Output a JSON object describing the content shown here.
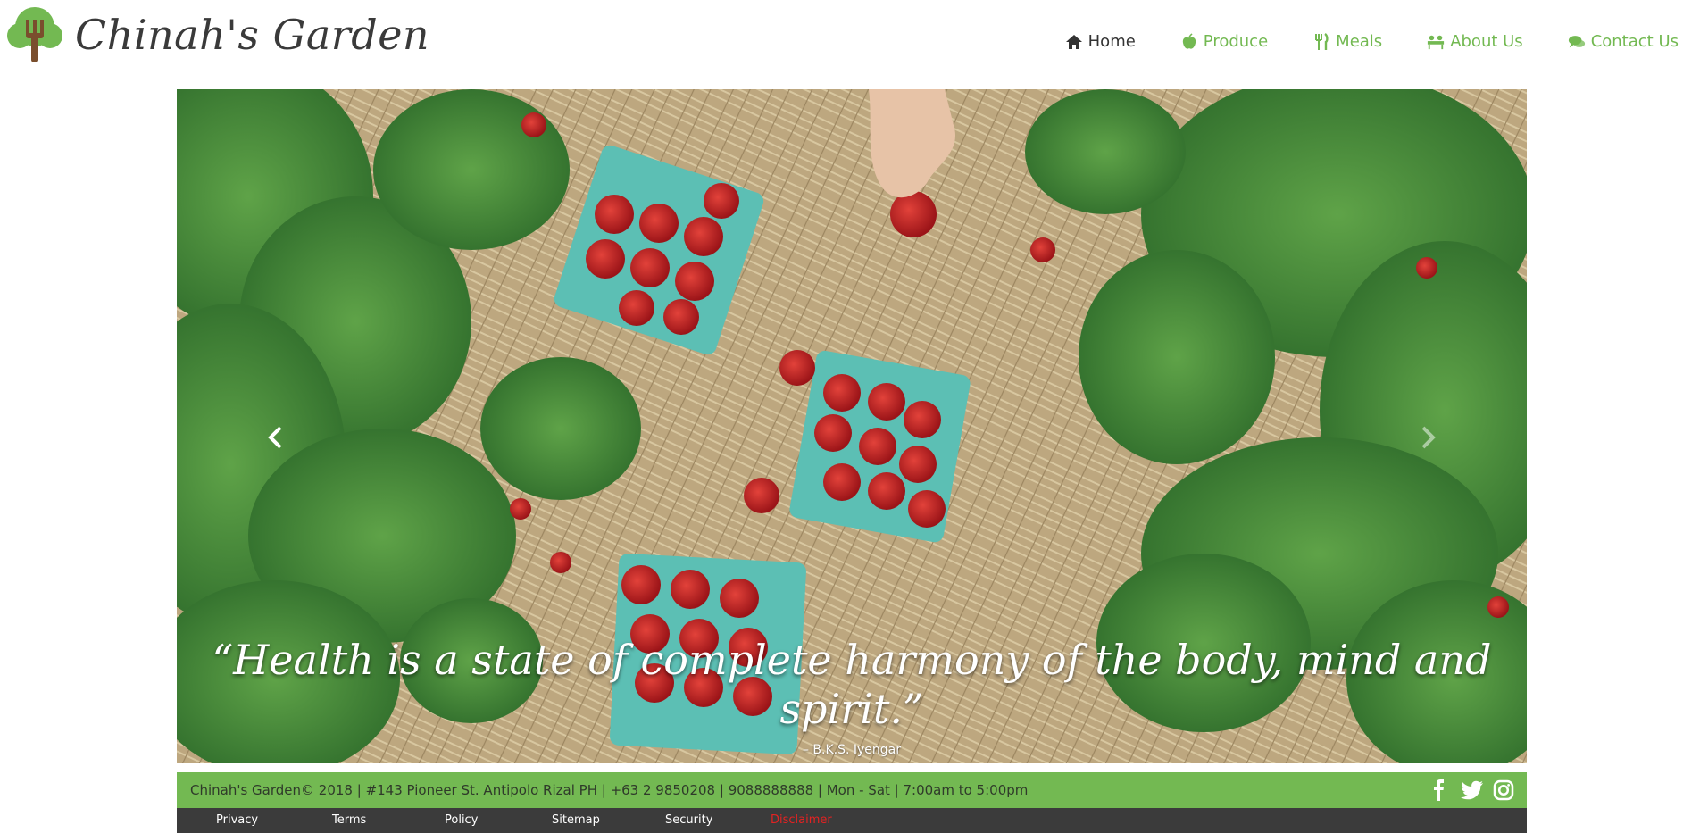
{
  "brand": {
    "name": "Chinah's Garden"
  },
  "nav": {
    "items": [
      {
        "label": "Home",
        "icon": "home-icon",
        "active": true
      },
      {
        "label": "Produce",
        "icon": "apple-icon"
      },
      {
        "label": "Meals",
        "icon": "cutlery-icon"
      },
      {
        "label": "About Us",
        "icon": "group-icon"
      },
      {
        "label": "Contact Us",
        "icon": "comments-icon"
      }
    ]
  },
  "carousel": {
    "quote": "“Health is a state of complete harmony of the body, mind and spirit.”",
    "author": "– B.K.S. Iyengar",
    "prev_icon": "chevron-left-icon",
    "next_icon": "chevron-right-icon"
  },
  "footer": {
    "info": "Chinah's Garden© 2018 | #143 Pioneer St. Antipolo Rizal PH | +63 2 9850208 | 9088888888 | Mon - Sat | 7:00am to 5:00pm",
    "socials": [
      "facebook-icon",
      "twitter-icon",
      "instagram-icon"
    ],
    "links": [
      "Privacy",
      "Terms",
      "Policy",
      "Sitemap",
      "Security",
      "Disclaimer"
    ]
  },
  "colors": {
    "accent": "#73b952",
    "dark_bar": "#3b3b3b",
    "disclaimer": "#e32222"
  }
}
